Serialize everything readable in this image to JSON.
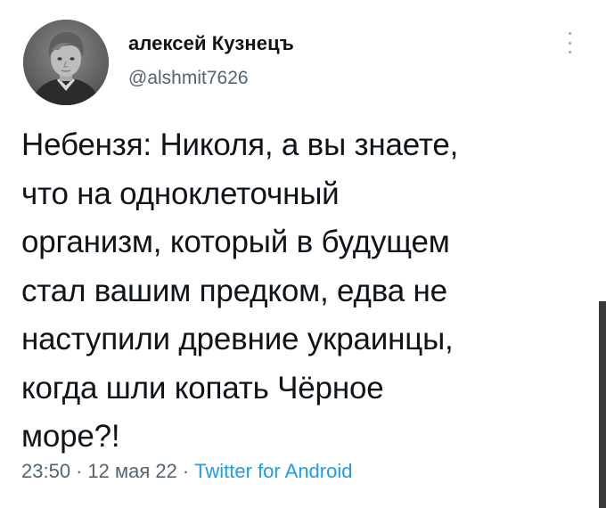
{
  "author": {
    "display_name": "алексей Кузнецъ",
    "handle": "@alshmit7626",
    "avatar_icon": "user-avatar-photo"
  },
  "more_icon": "vertical-ellipsis-icon",
  "tweet": {
    "lines": [
      "Небензя: Николя, а вы знаете,",
      "что на одноклеточный",
      "организм, который в будущем",
      "стал вашим предком, едва не",
      "наступили древние украинцы,",
      "когда шли копать Чёрное",
      "море?!"
    ]
  },
  "meta": {
    "time": "23:50",
    "separator": "·",
    "date": "12 мая 22",
    "source": "Twitter for Android"
  },
  "colors": {
    "text": "#0f1419",
    "secondary": "#536471",
    "link": "#1d9bf0"
  }
}
